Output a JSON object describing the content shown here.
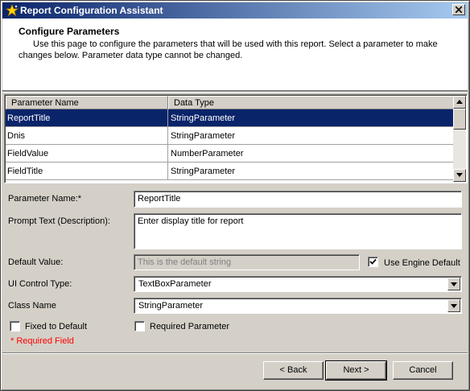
{
  "window": {
    "title": "Report Configuration Assistant",
    "icon": "wizard-star-icon",
    "close_icon": "close-icon"
  },
  "header": {
    "title": "Configure Parameters",
    "description": "Use this page to configure the parameters that will be used with this report.  Select a parameter to make changes below.  Parameter data type cannot be changed."
  },
  "grid": {
    "columns": [
      "Parameter Name",
      "Data Type"
    ],
    "rows": [
      {
        "name": "ReportTitle",
        "type": "StringParameter",
        "selected": true
      },
      {
        "name": "Dnis",
        "type": "StringParameter",
        "selected": false
      },
      {
        "name": "FieldValue",
        "type": "NumberParameter",
        "selected": false
      },
      {
        "name": "FieldTitle",
        "type": "StringParameter",
        "selected": false
      }
    ]
  },
  "form": {
    "parameter_name_label": "Parameter Name:*",
    "parameter_name_value": "ReportTitle",
    "prompt_text_label": "Prompt Text (Description):",
    "prompt_text_value": "Enter display title for report",
    "default_value_label": "Default Value:",
    "default_value_value": "This is the default string",
    "use_engine_default_label": "Use Engine Default",
    "use_engine_default_checked": true,
    "ui_control_type_label": "UI Control Type:",
    "ui_control_type_value": "TextBoxParameter",
    "class_name_label": "Class Name",
    "class_name_value": "StringParameter",
    "fixed_to_default_label": "Fixed to Default",
    "fixed_to_default_checked": false,
    "required_parameter_label": "Required Parameter",
    "required_parameter_checked": false,
    "required_field_note": "* Required Field"
  },
  "buttons": {
    "back": "< Back",
    "next": "Next >",
    "cancel": "Cancel"
  },
  "colors": {
    "title_gradient_start": "#0a246a",
    "selection": "#0a246a",
    "required_note": "#ff0000",
    "dialog_face": "#d4d0c8"
  }
}
